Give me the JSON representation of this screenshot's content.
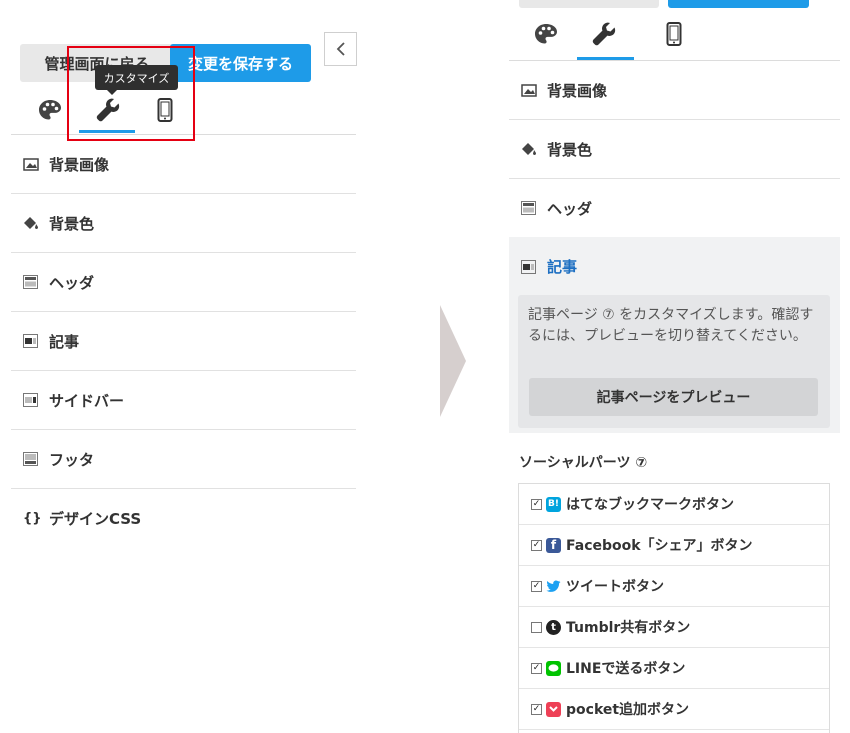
{
  "left_panel": {
    "back_button": "管理画面に戻る",
    "save_button": "変更を保存する",
    "tooltip": "カスタマイズ",
    "menu": [
      {
        "label": "背景画像",
        "icon": "image-icon"
      },
      {
        "label": "背景色",
        "icon": "paint-bucket-icon"
      },
      {
        "label": "ヘッダ",
        "icon": "header-layout-icon"
      },
      {
        "label": "記事",
        "icon": "article-layout-icon"
      },
      {
        "label": "サイドバー",
        "icon": "sidebar-layout-icon"
      },
      {
        "label": "フッタ",
        "icon": "footer-layout-icon"
      },
      {
        "label": "デザインCSS",
        "icon": "code-braces-icon"
      }
    ]
  },
  "right_panel": {
    "menu": [
      {
        "label": "背景画像",
        "icon": "image-icon"
      },
      {
        "label": "背景色",
        "icon": "paint-bucket-icon"
      },
      {
        "label": "ヘッダ",
        "icon": "header-layout-icon"
      },
      {
        "label": "記事",
        "icon": "article-layout-icon"
      }
    ],
    "article_description": "記事ページ ⑦ をカスタマイズします。確認するには、プレビューを切り替えてください。",
    "preview_button": "記事ページをプレビュー",
    "social_parts_title": "ソーシャルパーツ ⑦",
    "social_items": [
      {
        "label": "はてなブックマークボタン",
        "checked": true,
        "icon": "hatena-icon",
        "color": "#00a4de",
        "glyph": "B!"
      },
      {
        "label": "Facebook「シェア」ボタン",
        "checked": true,
        "icon": "facebook-icon",
        "color": "#3b5998",
        "glyph": "f"
      },
      {
        "label": "ツイートボタン",
        "checked": true,
        "icon": "twitter-icon",
        "color": "#1da1f2",
        "glyph": ""
      },
      {
        "label": "Tumblr共有ボタン",
        "checked": false,
        "icon": "tumblr-icon",
        "color": "#222222",
        "glyph": "t"
      },
      {
        "label": "LINEで送るボタン",
        "checked": true,
        "icon": "line-icon",
        "color": "#00c300",
        "glyph": ""
      },
      {
        "label": "pocket追加ボタン",
        "checked": true,
        "icon": "pocket-icon",
        "color": "#ee4056",
        "glyph": ""
      }
    ]
  },
  "colors": {
    "accent": "#1e9be8",
    "highlight_box": "#e50012",
    "article_link": "#1d6fc2"
  }
}
